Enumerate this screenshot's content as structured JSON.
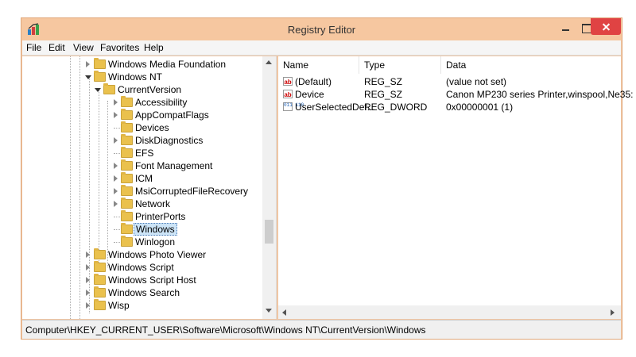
{
  "window": {
    "title": "Registry Editor",
    "accent": "#f6c7a0",
    "close_color": "#e04343"
  },
  "menubar": {
    "items": [
      "File",
      "Edit",
      "View",
      "Favorites",
      "Help"
    ]
  },
  "tree": {
    "items": [
      {
        "label": "Windows Media Foundation",
        "expander": "closed"
      },
      {
        "label": "Windows NT",
        "expander": "open"
      },
      {
        "label": "CurrentVersion",
        "expander": "open"
      },
      {
        "label": "Accessibility",
        "expander": "closed"
      },
      {
        "label": "AppCompatFlags",
        "expander": "closed"
      },
      {
        "label": "Devices",
        "expander": "none"
      },
      {
        "label": "DiskDiagnostics",
        "expander": "closed"
      },
      {
        "label": "EFS",
        "expander": "none"
      },
      {
        "label": "Font Management",
        "expander": "closed"
      },
      {
        "label": "ICM",
        "expander": "closed"
      },
      {
        "label": "MsiCorruptedFileRecovery",
        "expander": "closed"
      },
      {
        "label": "Network",
        "expander": "closed"
      },
      {
        "label": "PrinterPorts",
        "expander": "none"
      },
      {
        "label": "Windows",
        "expander": "none",
        "selected": true
      },
      {
        "label": "Winlogon",
        "expander": "none"
      },
      {
        "label": "Windows Photo Viewer",
        "expander": "closed"
      },
      {
        "label": "Windows Script",
        "expander": "closed"
      },
      {
        "label": "Windows Script Host",
        "expander": "closed"
      },
      {
        "label": "Windows Search",
        "expander": "closed"
      },
      {
        "label": "Wisp",
        "expander": "closed"
      }
    ]
  },
  "list": {
    "columns": [
      "Name",
      "Type",
      "Data"
    ],
    "rows": [
      {
        "icon": "string-value-icon",
        "name": "(Default)",
        "type": "REG_SZ",
        "data": "(value not set)"
      },
      {
        "icon": "string-value-icon",
        "name": "Device",
        "type": "REG_SZ",
        "data": "Canon MP230 series Printer,winspool,Ne35:"
      },
      {
        "icon": "binary-value-icon",
        "name": "UserSelectedDef...",
        "type": "REG_DWORD",
        "data": "0x00000001 (1)"
      }
    ]
  },
  "icons": {
    "string_glyph": "ab",
    "binary_glyph": "011 110"
  },
  "status": {
    "path": "Computer\\HKEY_CURRENT_USER\\Software\\Microsoft\\Windows NT\\CurrentVersion\\Windows"
  }
}
